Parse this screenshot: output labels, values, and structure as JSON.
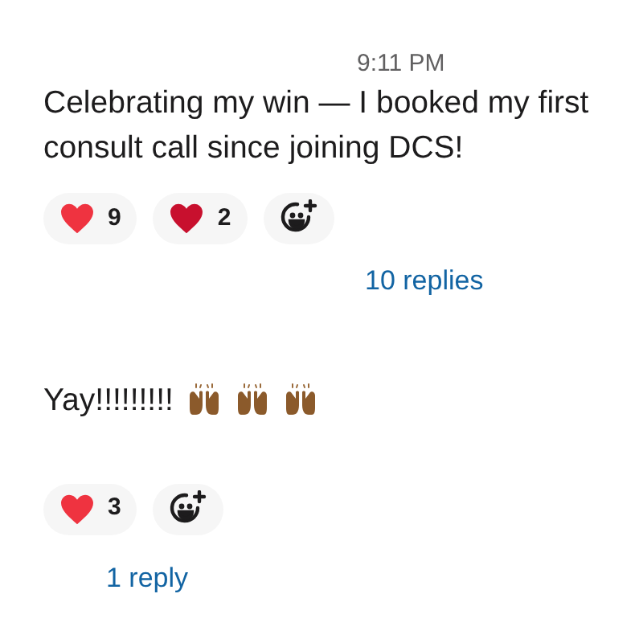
{
  "messages": [
    {
      "time": "9:11 PM",
      "text": "Celebrating my win — I booked my first consult call since joining DCS!",
      "reactions": [
        {
          "kind": "heart",
          "color": "#ef3340",
          "count": "9"
        },
        {
          "kind": "heart",
          "color": "#c8102e",
          "count": "2"
        },
        {
          "kind": "add"
        }
      ],
      "replies": "10 replies"
    },
    {
      "text": "Yay!!!!!!!!!",
      "emoji": [
        {
          "kind": "raised_hands"
        },
        {
          "kind": "raised_hands"
        },
        {
          "kind": "raised_hands"
        }
      ],
      "reactions": [
        {
          "kind": "heart",
          "color": "#ef3340",
          "count": "3"
        },
        {
          "kind": "add"
        }
      ],
      "replies": "1 reply"
    }
  ]
}
